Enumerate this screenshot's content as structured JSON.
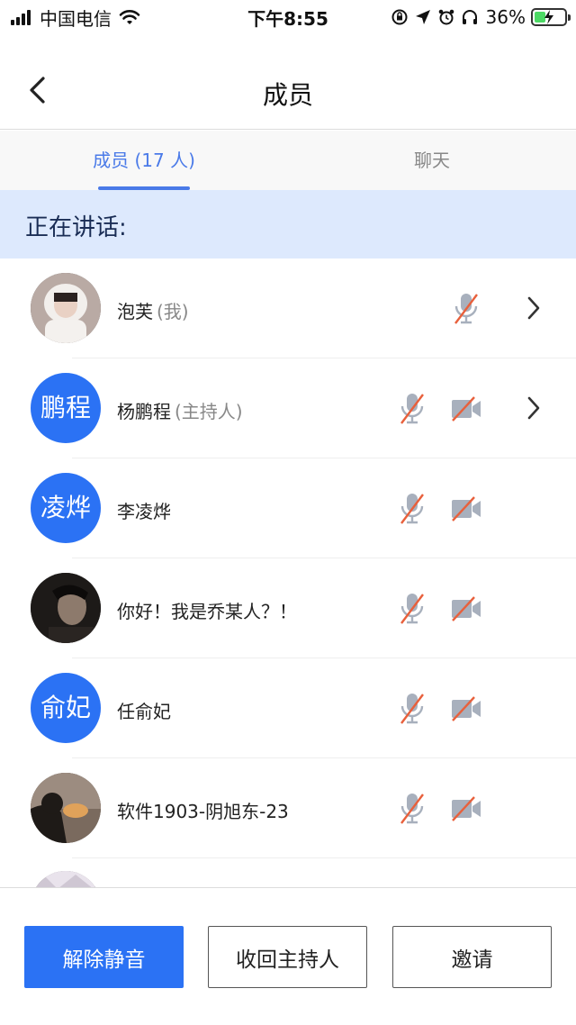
{
  "status_bar": {
    "carrier": "中国电信",
    "time": "下午8:55",
    "battery_percent": "36%",
    "battery_level": 0.36,
    "icons": [
      "signal-icon",
      "wifi-icon",
      "rotation-lock-icon",
      "location-icon",
      "alarm-icon",
      "headphones-icon",
      "battery-icon"
    ]
  },
  "header": {
    "title": "成员",
    "back_icon": "chevron-left-icon"
  },
  "tabs": [
    {
      "label": "成员 (17 人)",
      "active": true
    },
    {
      "label": "聊天",
      "active": false
    }
  ],
  "speaking_label": "正在讲话:",
  "members": [
    {
      "name": "泡芙",
      "role": "(我)",
      "avatar_type": "photo",
      "mic_muted": true,
      "show_camera": false,
      "show_chevron": true
    },
    {
      "name": "杨鹏程",
      "role": "(主持人)",
      "avatar_type": "text",
      "avatar_text": "鹏程",
      "mic_muted": true,
      "camera_off": true,
      "show_chevron": true
    },
    {
      "name": "李凌烨",
      "avatar_type": "text",
      "avatar_text": "凌烨",
      "mic_muted": true,
      "camera_off": true,
      "show_chevron": false
    },
    {
      "name": "你好！我是乔某人？！",
      "avatar_type": "photo",
      "mic_muted": true,
      "camera_off": true,
      "show_chevron": false
    },
    {
      "name": "任俞妃",
      "avatar_type": "text",
      "avatar_text": "俞妃",
      "mic_muted": true,
      "camera_off": true,
      "show_chevron": false
    },
    {
      "name": "软件1903-阴旭东-23",
      "avatar_type": "photo",
      "mic_muted": true,
      "camera_off": true,
      "show_chevron": false
    }
  ],
  "buttons": {
    "unmute": "解除静音",
    "reclaim_host": "收回主持人",
    "invite": "邀请"
  },
  "colors": {
    "accent": "#2b72f4",
    "tab_active": "#4a7ae8",
    "banner_bg": "#dde9fd",
    "muted_strike": "#e8603c"
  }
}
